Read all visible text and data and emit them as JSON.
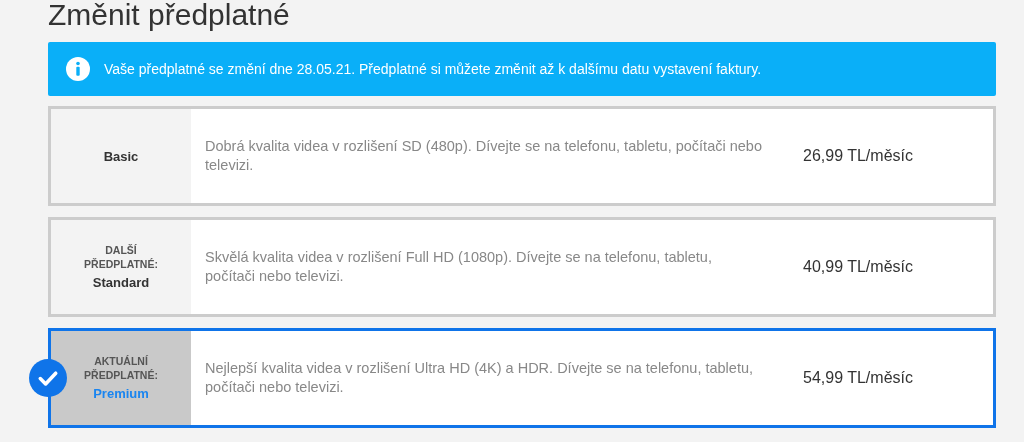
{
  "title": "Změnit předplatné",
  "notice": {
    "text": "Vaše předplatné se změní dne 28.05.21. Předplatné si můžete změnit až k dalšímu datu vystavení faktury."
  },
  "plans": [
    {
      "name": "Basic",
      "description": "Dobrá kvalita videa v rozlišení SD (480p). Dívejte se na telefonu, tabletu, počítači nebo televizi.",
      "price": "26,99 TL/měsíc",
      "selected": false
    },
    {
      "tag": "DALŠÍ PŘEDPLATNÉ:",
      "name": "Standard",
      "description": "Skvělá kvalita videa v rozlišení Full HD (1080p). Dívejte se na telefonu, tabletu, počítači nebo televizi.",
      "price": "40,99 TL/měsíc",
      "selected": false
    },
    {
      "tag": "AKTUÁLNÍ PŘEDPLATNÉ:",
      "name": "Premium",
      "description": "Nejlepší kvalita videa v rozlišení Ultra HD (4K) a HDR. Dívejte se na telefonu, tabletu, počítači nebo televizi.",
      "price": "54,99 TL/měsíc",
      "selected": true
    }
  ]
}
